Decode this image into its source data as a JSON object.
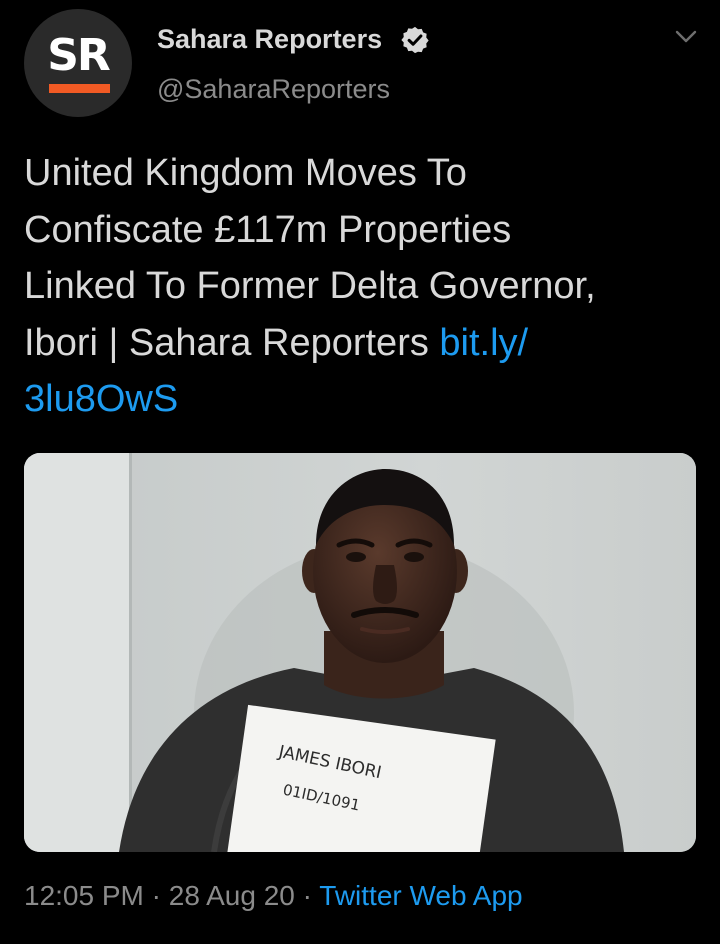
{
  "account": {
    "avatar_text": "SR",
    "name": "Sahara Reporters",
    "handle": "@SaharaReporters",
    "verified": true
  },
  "tweet": {
    "text": "United Kingdom Moves To\nConfiscate £117m Properties\nLinked To Former Delta Governor,\nIbori | Sahara Reporters ",
    "link": "bit.ly/\n3lu8OwS"
  },
  "media": {
    "sign_name": "JAMES IBORI",
    "sign_ref": "01ID/1091"
  },
  "meta": {
    "time": "12:05 PM",
    "separator": " · ",
    "date": "28 Aug 20",
    "source": "Twitter Web App"
  },
  "colors": {
    "background": "#000000",
    "text": "#d9d9d9",
    "muted": "#8b8b8b",
    "link": "#1d9bf0",
    "brand_accent": "#f15a24"
  },
  "icons": {
    "verified": "verified-badge-icon",
    "more": "chevron-down-icon"
  }
}
